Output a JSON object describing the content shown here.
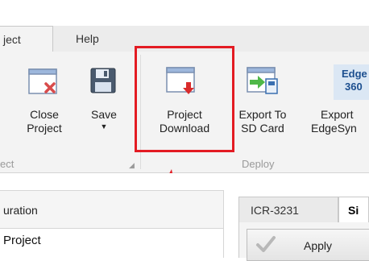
{
  "ribbon_tabs": [
    {
      "label": "ject",
      "active": true
    },
    {
      "label": "Help",
      "active": false
    }
  ],
  "project_group": {
    "close_project": {
      "line1": "Close",
      "line2": "Project",
      "icon": "close-project-icon"
    },
    "save": {
      "label": "Save",
      "caret": "▼",
      "icon": "floppy-disk-icon"
    },
    "group_label": "ect"
  },
  "deploy_group": {
    "project_download": {
      "line1": "Project",
      "line2": "Download",
      "icon": "project-download-icon"
    },
    "export_sd": {
      "line1": "Export To",
      "line2": "SD Card",
      "icon": "export-sd-card-icon"
    },
    "export_edgesync": {
      "line1": "Export",
      "line2": "EdgeSyn",
      "icon_line1": "Edge",
      "icon_line2": "360"
    },
    "group_label": "Deploy"
  },
  "annotation": {
    "highlight_color": "#e31b23",
    "arrow_color": "#e31b23"
  },
  "left_panel": {
    "header": "uration",
    "tree_item": "Project"
  },
  "doc_tabs": [
    {
      "label": "ICR-3231",
      "selected": false
    },
    {
      "label": "Si",
      "selected": true
    }
  ],
  "apply_button": {
    "label": "Apply"
  }
}
